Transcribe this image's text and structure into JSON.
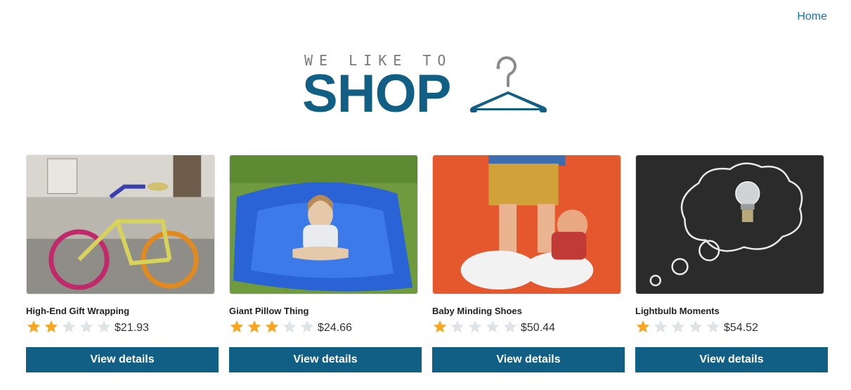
{
  "nav": {
    "home_label": "Home"
  },
  "logo": {
    "tagline": "WE LIKE TO",
    "wordmark": "SHOP",
    "icon": "hanger-icon"
  },
  "colors": {
    "brand": "#125f86",
    "star_filled": "#f5a623",
    "star_empty": "#dfe3e6",
    "link": "#1a73b8"
  },
  "products": [
    {
      "title": "High-End Gift Wrapping",
      "rating": 2,
      "max_rating": 5,
      "price": "$21.93",
      "button_label": "View details",
      "image": "yarn-bombed-bicycle"
    },
    {
      "title": "Giant Pillow Thing",
      "rating": 3,
      "max_rating": 5,
      "price": "$24.66",
      "button_label": "View details",
      "image": "girl-on-blue-beanbag"
    },
    {
      "title": "Baby Minding Shoes",
      "rating": 1,
      "max_rating": 5,
      "price": "$50.44",
      "button_label": "View details",
      "image": "figurine-shoes-orange"
    },
    {
      "title": "Lightbulb Moments",
      "rating": 1,
      "max_rating": 5,
      "price": "$54.52",
      "button_label": "View details",
      "image": "lightbulb-chalkboard"
    }
  ]
}
